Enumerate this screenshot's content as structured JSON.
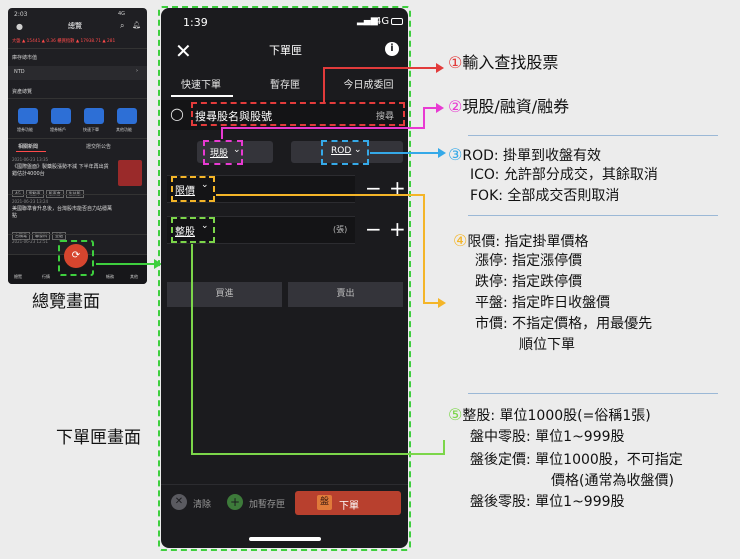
{
  "mini": {
    "time": "2:03",
    "network": "4G",
    "title": "總覽",
    "index_row": "大盤  ▲ 15441 ▲ 0.36  櫃買指數 ▲ 17938.71 ▲ 281",
    "section_watch": "庫存總市值",
    "nto_label": "NTD",
    "section_assets": "資產總覽",
    "quick_buttons": [
      "證券功能",
      "證券帳戶",
      "快速下單",
      "其他功能"
    ],
    "news_tabs": [
      "相關新聞",
      "證交所公告"
    ],
    "news": [
      {
        "date": "2021-06-23 13:35",
        "text": "《國際盤面》製藥股漲勢不減 下半年再出貨錯估計4000台",
        "tags": [
          "4G",
          "電動車",
          "股東會",
          "生技股"
        ]
      },
      {
        "date": "2021-06-23 13:24",
        "text": "美國聯準會升息後，台灣股市能否自力站穩萬點",
        "tags": [
          "台積電",
          "聯發科",
          "金融"
        ]
      },
      {
        "date": "2021-06-23 12:51",
        "text": "",
        "tags": []
      }
    ],
    "nav": [
      "總覽",
      "行情",
      "下單",
      "帳務",
      "其他"
    ]
  },
  "phone": {
    "time": "1:39",
    "network": "4G",
    "title": "下單匣",
    "close_icon": "close-icon",
    "info_icon": "info-icon",
    "tabs": [
      "快速下單",
      "暫存匣",
      "今日成委回"
    ],
    "search_placeholder": "搜尋股名與股號",
    "search_button": "搜尋",
    "market_type": "現股",
    "order_condition": "ROD",
    "price_type": "限價",
    "lot_type": "整股",
    "qty_unit": "(張)",
    "minus": "−",
    "plus": "+",
    "buy": "買進",
    "sell": "賣出",
    "clear": "清除",
    "save_to_tray": "加暫存匣",
    "place_order_tag": "盤",
    "place_order": "下單"
  },
  "labels": {
    "overview": "總覽畫面",
    "order_tray": "下單匣畫面"
  },
  "annotations": {
    "a1": {
      "num": "①",
      "text": "輸入查找股票"
    },
    "a2": {
      "num": "②",
      "text": "現股/融資/融券"
    },
    "a3": {
      "num": "③",
      "lines": [
        "ROD: 掛單到收盤有效",
        "ICO: 允許部分成交，其餘取消",
        "FOK: 全部成交否則取消"
      ]
    },
    "a4": {
      "num": "④",
      "lines": [
        "限價: 指定掛單價格",
        "漲停: 指定漲停價",
        "跌停: 指定跌停價",
        "平盤: 指定昨日收盤價",
        "市價: 不指定價格，用最優先",
        "順位下單"
      ]
    },
    "a5": {
      "num": "⑤",
      "lines": [
        "整股: 單位1000股(=俗稱1張)",
        "盤中零股: 單位1~999股",
        "盤後定價: 單位1000股，不可指定",
        "價格(通常為收盤價)",
        "盤後零股: 單位1~999股"
      ]
    }
  },
  "colors": {
    "red": "#e23b3b",
    "pink": "#e83ad2",
    "blue": "#35a9e8",
    "yellow": "#f4b528",
    "green": "#7cd64a",
    "order_button": "#b8402e"
  }
}
